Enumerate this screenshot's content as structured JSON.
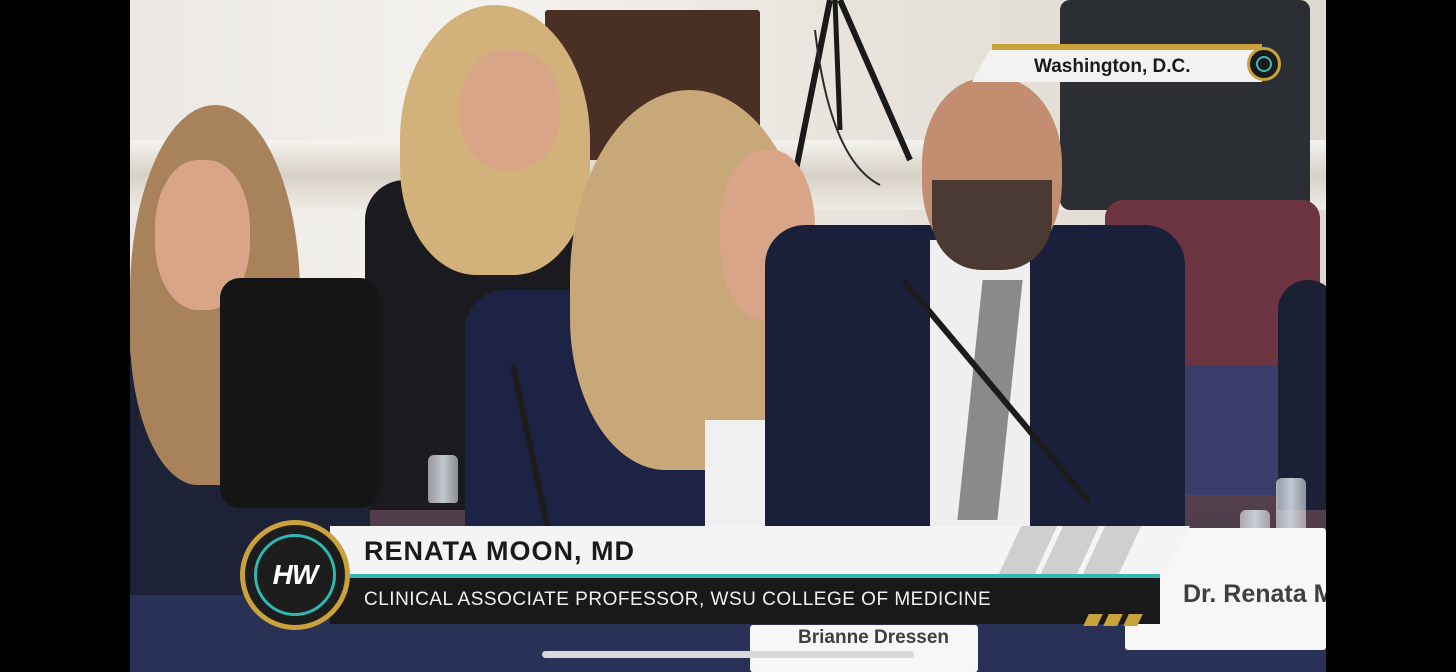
{
  "location_badge": {
    "text": "Washington, D.C."
  },
  "lower_third": {
    "logo_text": "HW",
    "name": "RENATA MOON, MD",
    "title": "CLINICAL ASSOCIATE PROFESSOR, WSU COLLEGE OF MEDICINE"
  },
  "placards": {
    "right": "Dr. Renata Moo",
    "center": "Brianne Dressen"
  },
  "colors": {
    "accent_gold": "#c9a23b",
    "accent_teal": "#2fb7b0",
    "bar_dark": "#191919",
    "bar_light": "#f4f4f4"
  }
}
